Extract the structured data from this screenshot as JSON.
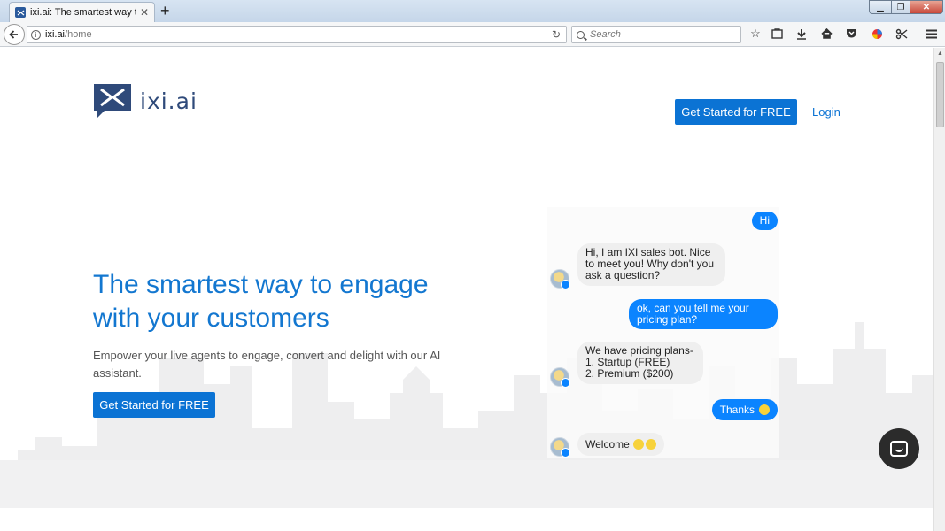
{
  "browser": {
    "tab_title": "ixi.ai: The smartest way to en",
    "tab_close": "✕",
    "new_tab": "+",
    "url_host": "ixi.ai",
    "url_path": "/home",
    "search_placeholder": "Search",
    "toolbar_icons": [
      "back-icon",
      "info-icon",
      "reload-icon",
      "bookmark-star-icon",
      "reading-list-icon",
      "download-icon",
      "home-icon",
      "pocket-icon",
      "extension-icon",
      "screenshot-icon",
      "menu-icon"
    ]
  },
  "header": {
    "logo_text": "ixi.ai",
    "cta_label": "Get Started for FREE",
    "login_label": "Login"
  },
  "hero": {
    "title": "The smartest way to engage with your customers",
    "subtitle": "Empower your live agents to engage, convert and delight with our AI assistant.",
    "cta_label": "Get Started for FREE"
  },
  "chat": {
    "messages": [
      {
        "from": "user",
        "text": "Hi"
      },
      {
        "from": "bot",
        "text": "Hi, I am IXI sales bot. Nice\nto meet you! Why don't you\nask a question?"
      },
      {
        "from": "user",
        "text": "ok, can you tell me your\npricing plan?"
      },
      {
        "from": "bot",
        "text": "We have pricing plans-\n1. Startup (FREE)\n2. Premium ($200)"
      },
      {
        "from": "user",
        "text": "Thanks"
      },
      {
        "from": "bot",
        "text": "Welcome"
      }
    ]
  },
  "colors": {
    "brand_blue": "#0b73d4",
    "chat_user_blue": "#0b84ff",
    "logo_navy": "#2f4a7a"
  }
}
